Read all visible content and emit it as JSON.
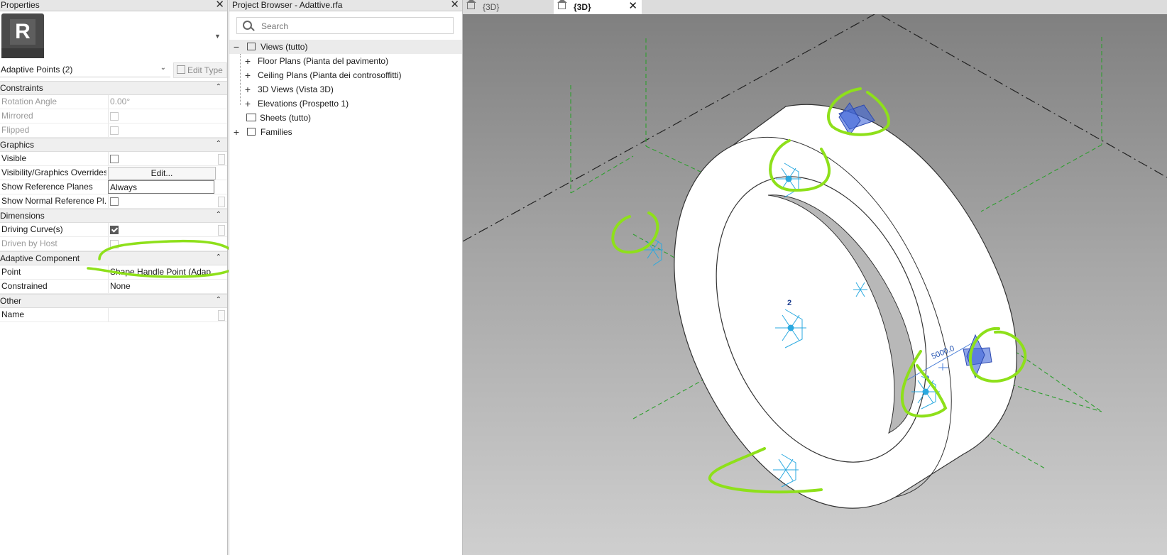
{
  "properties": {
    "title": "Properties",
    "close": "✕",
    "type_icon_letter": "R",
    "type_name": "Adaptive Points (2)",
    "edit_type": "Edit Type",
    "sections": {
      "constraints": "Constraints",
      "graphics": "Graphics",
      "dimensions": "Dimensions",
      "adaptive": "Adaptive Component",
      "other": "Other"
    },
    "rows": {
      "rotation_angle": {
        "label": "Rotation Angle",
        "value": "0.00°"
      },
      "mirrored": {
        "label": "Mirrored"
      },
      "flipped": {
        "label": "Flipped"
      },
      "visible": {
        "label": "Visible"
      },
      "vg_overrides": {
        "label": "Visibility/Graphics Overrides",
        "value": "Edit..."
      },
      "show_ref_planes": {
        "label": "Show Reference Planes",
        "value": "Always"
      },
      "show_normal_ref": {
        "label": "Show Normal Reference Pl..."
      },
      "driving_curves": {
        "label": "Driving Curve(s)"
      },
      "driven_by_host": {
        "label": "Driven by Host"
      },
      "point": {
        "label": "Point",
        "value": "Shape Handle Point (Adap..."
      },
      "constrained": {
        "label": "Constrained",
        "value": "None"
      },
      "name": {
        "label": "Name",
        "value": ""
      }
    }
  },
  "browser": {
    "title": "Project Browser - Adattive.rfa",
    "close": "✕",
    "search_placeholder": "Search",
    "tree": {
      "views": {
        "label": "Views (tutto)",
        "toggle": "−"
      },
      "floor_plans": {
        "label": "Floor Plans (Pianta del pavimento)",
        "toggle": "+"
      },
      "ceiling_plans": {
        "label": "Ceiling Plans (Pianta dei controsoffitti)",
        "toggle": "+"
      },
      "views_3d": {
        "label": "3D Views (Vista 3D)",
        "toggle": "+"
      },
      "elevations": {
        "label": "Elevations (Prospetto 1)",
        "toggle": "+"
      },
      "sheets": {
        "label": "Sheets (tutto)"
      },
      "families": {
        "label": "Families",
        "toggle": "+"
      }
    }
  },
  "viewport": {
    "tabs": [
      {
        "label": "{3D}"
      },
      {
        "label": "{3D}",
        "close": "✕"
      }
    ],
    "dimension_label": "5000.0",
    "point_number": "2"
  },
  "colors": {
    "annotation_green": "#8ee01a",
    "handle_blue": "#2aa9e0",
    "selected_blue": "#3f66d8",
    "ref_plane_green": "#2e9e2e"
  }
}
